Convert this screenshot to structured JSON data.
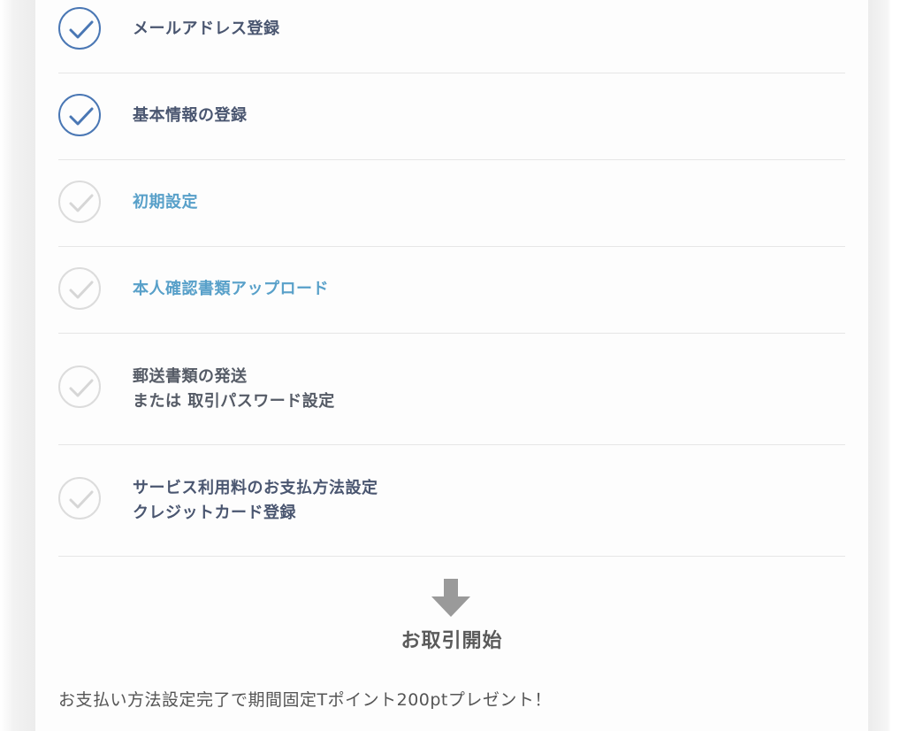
{
  "steps": [
    {
      "status": "done",
      "lines": [
        "メールアドレス登録"
      ]
    },
    {
      "status": "done",
      "lines": [
        "基本情報の登録"
      ]
    },
    {
      "status": "todo",
      "lines": [
        "初期設定"
      ]
    },
    {
      "status": "todo",
      "lines": [
        "本人確認書類アップロード"
      ]
    },
    {
      "status": "todo",
      "lines": [
        "郵送書類の発送",
        "または 取引パスワード設定"
      ]
    },
    {
      "status": "todo",
      "lines": [
        "サービス利用料のお支払方法設定",
        "クレジットカード登録"
      ]
    }
  ],
  "start_label": "お取引開始",
  "promo_text": "お支払い方法設定完了で期間固定Tポイント200ptプレゼント！",
  "colors": {
    "done_check": "#4a77b4",
    "todo_check": "#dcdcdc",
    "active_label": "#58a0c9",
    "label": "#555b66"
  },
  "icons": {
    "done": "check-circle-icon",
    "todo": "check-circle-outline-icon",
    "flow": "arrow-down-icon"
  }
}
